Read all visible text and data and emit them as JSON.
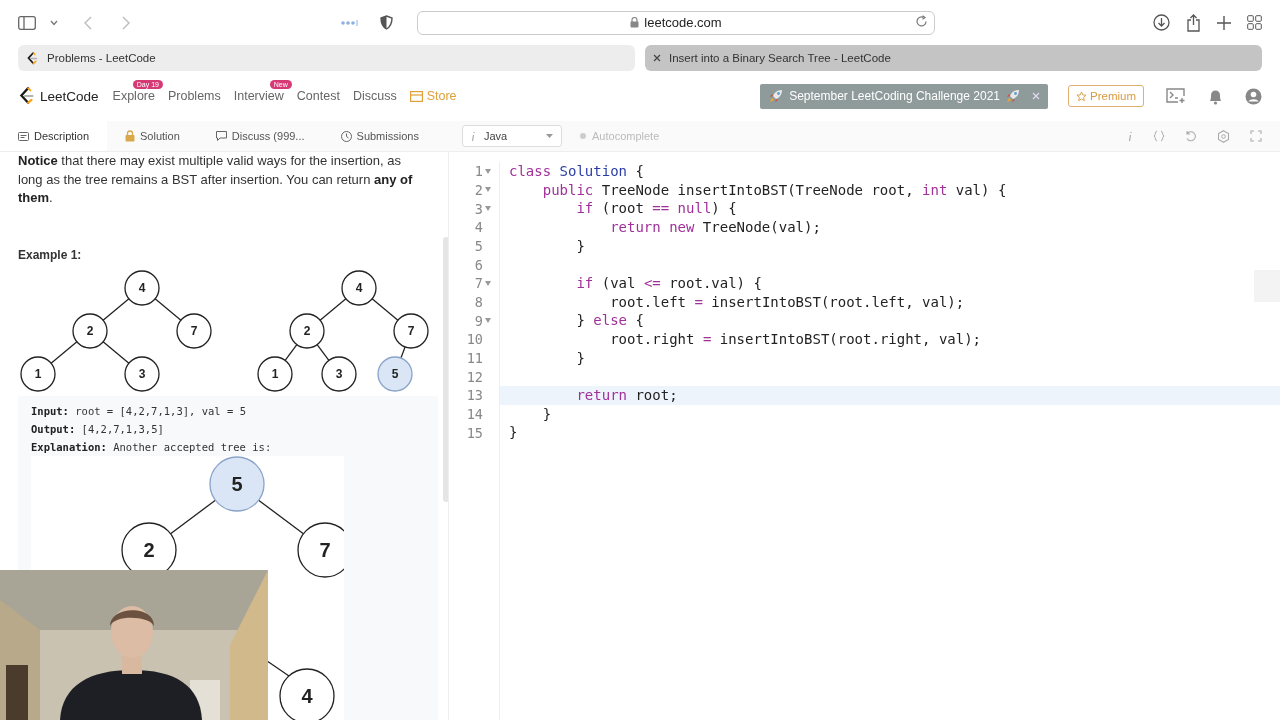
{
  "browser": {
    "address": "leetcode.com",
    "tabs": [
      {
        "title": "Problems - LeetCode",
        "selected": false
      },
      {
        "title": "Insert into a Binary Search Tree - LeetCode",
        "selected": true
      }
    ]
  },
  "nav": {
    "brand": "LeetCode",
    "items": [
      {
        "label": "Explore",
        "badge": "Day 19",
        "kind": "link"
      },
      {
        "label": "Problems",
        "kind": "link"
      },
      {
        "label": "Interview",
        "badge": "New",
        "kind": "link"
      },
      {
        "label": "Contest",
        "kind": "link"
      },
      {
        "label": "Discuss",
        "kind": "link"
      },
      {
        "label": "Store",
        "kind": "store"
      }
    ],
    "banner": "September LeetCoding Challenge 2021",
    "premium": "Premium"
  },
  "panel_tabs": [
    {
      "label": "Description",
      "selected": true
    },
    {
      "label": "Solution",
      "selected": false
    },
    {
      "label": "Discuss (999...",
      "selected": false
    },
    {
      "label": "Submissions",
      "selected": false
    }
  ],
  "editor_toolbar": {
    "language": "Java",
    "autocomplete": {
      "label": "Autocomplete",
      "on": false
    }
  },
  "description": {
    "paragraph": "**Notice** that there may exist multiple valid ways for the insertion, as long as the tree remains a BST after insertion. You can return **any of them**.",
    "example_title": "Example 1:",
    "trees": [
      {
        "value": "4",
        "highlighted": false,
        "children": [
          {
            "value": "2",
            "highlighted": false,
            "children": [
              {
                "value": "1",
                "highlighted": false
              },
              {
                "value": "3",
                "highlighted": false
              }
            ]
          },
          {
            "value": "7",
            "highlighted": false
          }
        ]
      },
      {
        "value": "4",
        "highlighted": false,
        "children": [
          {
            "value": "2",
            "highlighted": false,
            "children": [
              {
                "value": "1",
                "highlighted": false
              },
              {
                "value": "3",
                "highlighted": false
              }
            ]
          },
          {
            "value": "7",
            "highlighted": false,
            "children": [
              {
                "value": "5",
                "highlighted": true
              }
            ]
          }
        ]
      }
    ],
    "lines": [
      {
        "label": "Input:",
        "value": "root = [4,2,7,1,3], val = 5"
      },
      {
        "label": "Output:",
        "value": "[4,2,7,1,3,5]"
      },
      {
        "label": "Explanation:",
        "value": "Another accepted tree is:"
      }
    ],
    "explanation_tree": {
      "value": "5",
      "highlighted": true,
      "children": [
        {
          "value": "2",
          "highlighted": false
        },
        {
          "value": "7",
          "highlighted": false
        }
      ]
    },
    "partial_nodes": [
      {
        "value": "4",
        "highlighted": false
      }
    ]
  },
  "code": [
    {
      "n": "1",
      "fold": true,
      "active": false,
      "tokens": [
        {
          "kind": "keyword",
          "text": "class"
        },
        {
          "kind": "def",
          "text": " Solution"
        },
        {
          "kind": "plain",
          "text": " {"
        }
      ]
    },
    {
      "n": "2",
      "fold": true,
      "active": false,
      "tokens": [
        {
          "kind": "keyword",
          "text": "    public"
        },
        {
          "kind": "plain",
          "text": " TreeNode insertIntoBST(TreeNode root, "
        },
        {
          "kind": "keyword",
          "text": "int"
        },
        {
          "kind": "plain",
          "text": " val) {"
        }
      ]
    },
    {
      "n": "3",
      "fold": true,
      "active": false,
      "tokens": [
        {
          "kind": "keyword",
          "text": "        if"
        },
        {
          "kind": "plain",
          "text": " (root "
        },
        {
          "kind": "operator",
          "text": "=="
        },
        {
          "kind": "keyword",
          "text": " null"
        },
        {
          "kind": "plain",
          "text": ") {"
        }
      ]
    },
    {
      "n": "4",
      "fold": false,
      "active": false,
      "tokens": [
        {
          "kind": "keyword",
          "text": "            return new"
        },
        {
          "kind": "plain",
          "text": " TreeNode(val);"
        }
      ]
    },
    {
      "n": "5",
      "fold": false,
      "active": false,
      "tokens": [
        {
          "kind": "plain",
          "text": "        }"
        }
      ]
    },
    {
      "n": "6",
      "fold": false,
      "active": false
    },
    {
      "n": "7",
      "fold": true,
      "active": false,
      "tokens": [
        {
          "kind": "keyword",
          "text": "        if"
        },
        {
          "kind": "plain",
          "text": " (val "
        },
        {
          "kind": "operator",
          "text": "<="
        },
        {
          "kind": "plain",
          "text": " root.val) {"
        }
      ]
    },
    {
      "n": "8",
      "fold": false,
      "active": false,
      "tokens": [
        {
          "kind": "plain",
          "text": "            root.left "
        },
        {
          "kind": "operator",
          "text": "="
        },
        {
          "kind": "plain",
          "text": " insertIntoBST(root.left, val);"
        }
      ]
    },
    {
      "n": "9",
      "fold": true,
      "active": false,
      "tokens": [
        {
          "kind": "plain",
          "text": "        } "
        },
        {
          "kind": "keyword",
          "text": "else"
        },
        {
          "kind": "plain",
          "text": " {"
        }
      ]
    },
    {
      "n": "10",
      "fold": false,
      "active": false,
      "tokens": [
        {
          "kind": "plain",
          "text": "            root.right "
        },
        {
          "kind": "operator",
          "text": "="
        },
        {
          "kind": "plain",
          "text": " insertIntoBST(root.right, val);"
        }
      ]
    },
    {
      "n": "11",
      "fold": false,
      "active": false,
      "tokens": [
        {
          "kind": "plain",
          "text": "        }"
        }
      ]
    },
    {
      "n": "12",
      "fold": false,
      "active": false
    },
    {
      "n": "13",
      "fold": false,
      "active": true,
      "tokens": [
        {
          "kind": "keyword",
          "text": "        return"
        },
        {
          "kind": "plain",
          "text": " root;"
        }
      ]
    },
    {
      "n": "14",
      "fold": false,
      "active": false,
      "tokens": [
        {
          "kind": "plain",
          "text": "    }"
        }
      ]
    },
    {
      "n": "15",
      "fold": false,
      "active": false,
      "tokens": [
        {
          "kind": "plain",
          "text": "}"
        }
      ]
    }
  ]
}
